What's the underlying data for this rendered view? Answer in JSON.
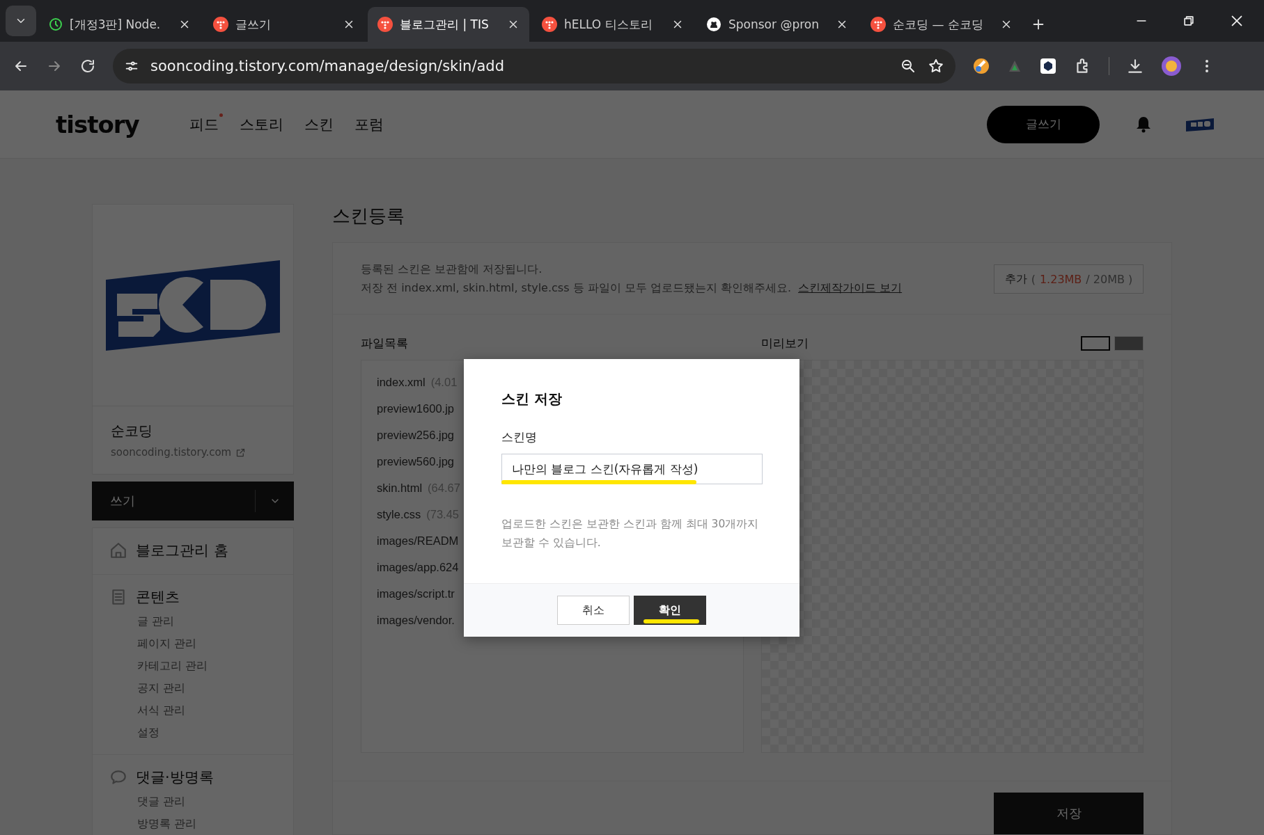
{
  "browser": {
    "tabs": [
      {
        "title": "[개정3판] Node.",
        "kind": "clock",
        "selected": false
      },
      {
        "title": "글쓰기",
        "kind": "tistory",
        "selected": false
      },
      {
        "title": "블로그관리 | TIS",
        "kind": "tistory",
        "selected": true
      },
      {
        "title": "hELLO 티스토리",
        "kind": "tistory",
        "selected": false
      },
      {
        "title": "Sponsor @pron",
        "kind": "github",
        "selected": false
      },
      {
        "title": "순코딩 — 순코딩",
        "kind": "tistory",
        "selected": false
      }
    ],
    "address": "sooncoding.tistory.com/manage/design/skin/add"
  },
  "header": {
    "logo": "tistory",
    "nav": [
      {
        "label": "피드",
        "badge": true
      },
      {
        "label": "스토리",
        "badge": false
      },
      {
        "label": "스킨",
        "badge": false
      },
      {
        "label": "포럼",
        "badge": false
      }
    ],
    "write_button": "글쓰기"
  },
  "sidebar": {
    "blog_name": "순코딩",
    "blog_url": "sooncoding.tistory.com",
    "write_button": "쓰기",
    "sections": [
      {
        "title": "블로그관리 홈",
        "kind": "home"
      },
      {
        "title": "콘텐츠",
        "kind": "document",
        "items": [
          "글 관리",
          "페이지 관리",
          "카테고리 관리",
          "공지 관리",
          "서식 관리",
          "설정"
        ]
      },
      {
        "title": "댓글·방명록",
        "kind": "chat",
        "items": [
          "댓글 관리",
          "방명록 관리"
        ]
      }
    ]
  },
  "main": {
    "title": "스킨등록",
    "notice": [
      "등록된 스킨은 보관함에 저장됩니다.",
      "저장 전 index.xml, skin.html, style.css 등 파일이 모두 업로드됐는지 확인해주세요."
    ],
    "guide_link": "스킨제작가이드 보기",
    "add_button": {
      "label": "추가",
      "open": "(",
      "used": "1.23MB",
      "rest": "/ 20MB )"
    },
    "file_list_title": "파일목록",
    "files": [
      {
        "name": "index.xml",
        "size": "(4.01"
      },
      {
        "name": "preview1600.jp"
      },
      {
        "name": "preview256.jpg"
      },
      {
        "name": "preview560.jpg"
      },
      {
        "name": "skin.html",
        "size": "(64.67"
      },
      {
        "name": "style.css",
        "size": "(73.45"
      },
      {
        "name": "images/READM"
      },
      {
        "name": "images/app.624"
      },
      {
        "name": "images/script.tr"
      },
      {
        "name": "images/vendor."
      }
    ],
    "preview_title": "미리보기",
    "preview_modes": [
      {
        "kind": "light",
        "selected": true
      },
      {
        "kind": "dark",
        "selected": false
      }
    ],
    "save_button": "저장"
  },
  "dialog": {
    "title": "스킨 저장",
    "field_label": "스킨명",
    "value": "나만의 블로그 스킨(자유롭게 작성)",
    "note": "업로드한 스킨은 보관한 스킨과 함께 최대 30개까지 보관할 수 있습니다.",
    "cancel": "취소",
    "confirm": "확인"
  }
}
